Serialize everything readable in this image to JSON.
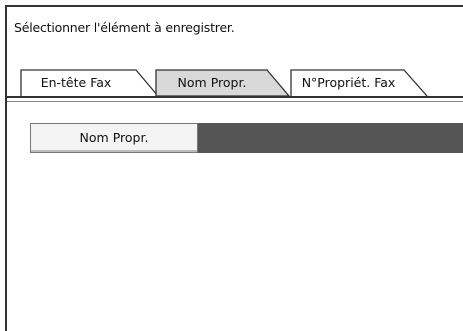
{
  "instruction": "Sélectionner l'élément à enregistrer.",
  "tabs": [
    {
      "label": "En-tête Fax",
      "selected": false
    },
    {
      "label": "Nom Propr.",
      "selected": true
    },
    {
      "label": "N°Propriét. Fax",
      "selected": false
    }
  ],
  "content": {
    "item_label": "Nom Propr."
  },
  "colors": {
    "selected_tab_bg": "#d9d9d9",
    "dark_bar": "#555555"
  }
}
